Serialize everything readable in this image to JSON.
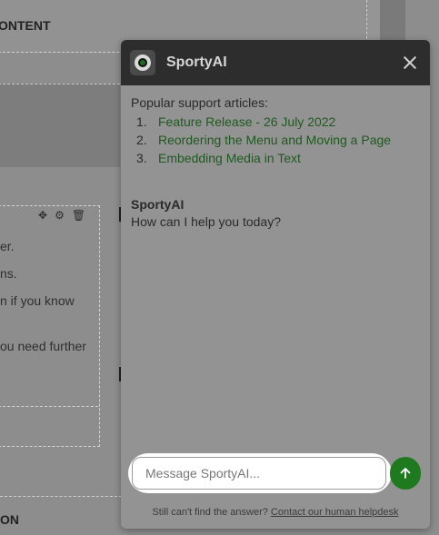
{
  "background": {
    "content_label": "ONTENT",
    "module_lines": [
      "er.",
      "ns.",
      "n if you know",
      "ou need further"
    ],
    "bottom_label": "ON"
  },
  "chat": {
    "title": "SportyAI",
    "articles_heading": "Popular support articles:",
    "articles": [
      {
        "num": "1.",
        "title": "Feature Release - 26 July 2022"
      },
      {
        "num": "2.",
        "title": "Reordering the Menu and Moving a Page"
      },
      {
        "num": "3.",
        "title": "Embedding Media in Text"
      }
    ],
    "message": {
      "author": "SportyAI",
      "text": "How can I help you today?"
    },
    "input_placeholder": "Message SportyAI...",
    "footer_text": "Still can't find the answer?",
    "footer_link": "Contact our human helpdesk"
  },
  "colors": {
    "header_bg": "#2d2d2d",
    "accent_green": "#1f7a1f",
    "link_green": "#1f5a1f"
  }
}
